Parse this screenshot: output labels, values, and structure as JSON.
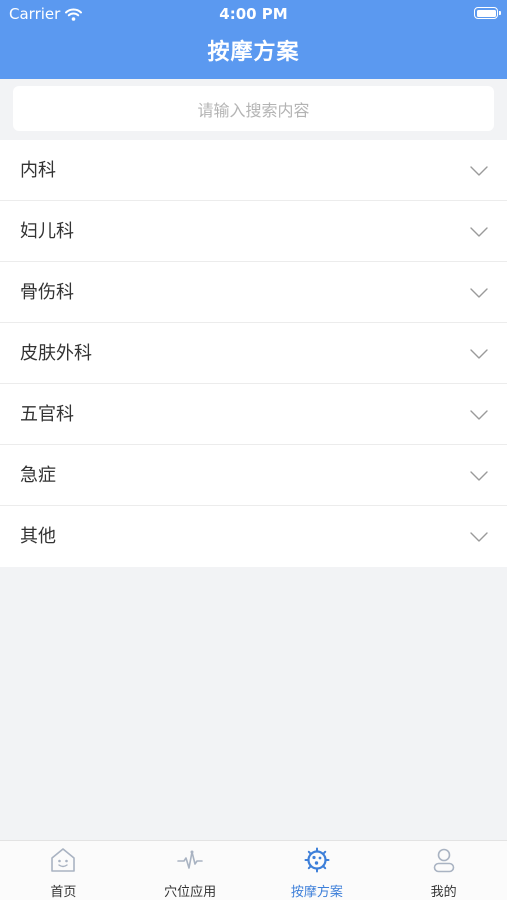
{
  "status_bar": {
    "carrier": "Carrier",
    "time": "4:00 PM"
  },
  "header": {
    "title": "按摩方案"
  },
  "search": {
    "placeholder": "请输入搜索内容"
  },
  "categories": [
    {
      "label": "内科"
    },
    {
      "label": "妇儿科"
    },
    {
      "label": "骨伤科"
    },
    {
      "label": "皮肤外科"
    },
    {
      "label": "五官科"
    },
    {
      "label": "急症"
    },
    {
      "label": "其他"
    }
  ],
  "tabbar": {
    "tabs": [
      {
        "label": "首页",
        "icon": "home-icon"
      },
      {
        "label": "穴位应用",
        "icon": "pulse-icon"
      },
      {
        "label": "按摩方案",
        "icon": "massage-virus-icon",
        "active": true
      },
      {
        "label": "我的",
        "icon": "user-icon"
      }
    ]
  },
  "colors": {
    "brand": "#5b99f0",
    "active_tab": "#3d7fd9",
    "background": "#f2f3f5"
  }
}
